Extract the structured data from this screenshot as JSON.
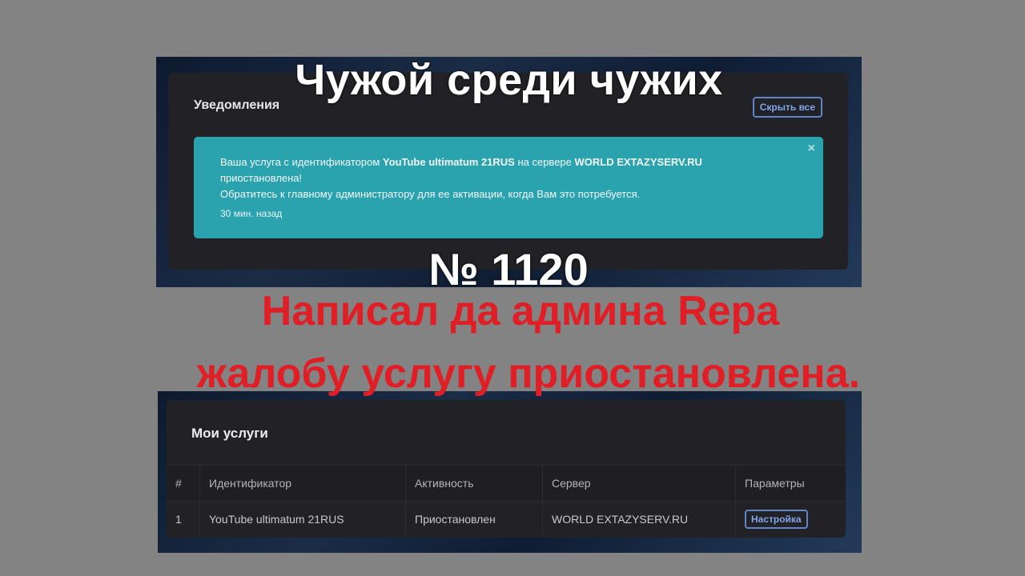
{
  "overlay": {
    "title": "Чужой среди чужих",
    "number": "№ 1120",
    "caption_line1": "Написал да админа Repa",
    "caption_line2": "жалобу услугу приостановлена."
  },
  "notifications": {
    "title": "Уведомления",
    "hide_all_label": "Скрыть все",
    "close_glyph": "×",
    "alert": {
      "text_prefix": "Ваша услуга с идентификатором ",
      "service_id": "YouTube ultimatum 21RUS",
      "text_middle": " на сервере ",
      "server": "WORLD EXTAZYSERV.RU",
      "text_suffix": " приостановлена!",
      "line2": "Обратитесь к главному администратору для ее активации, когда Вам это потребуется.",
      "time": "30 мин. назад"
    }
  },
  "services": {
    "title": "Мои услуги",
    "columns": [
      "#",
      "Идентификатор",
      "Активность",
      "Сервер",
      "Параметры"
    ],
    "rows": [
      {
        "num": "1",
        "id": "YouTube ultimatum 21RUS",
        "status": "Приостановлен",
        "server": "WORLD EXTAZYSERV.RU",
        "action_label": "Настройка"
      }
    ]
  },
  "colors": {
    "accent_blue": "#5f86c9",
    "alert_teal": "#2aa3af",
    "status_suspended": "#e0673a",
    "caption_red": "#e01e26"
  }
}
